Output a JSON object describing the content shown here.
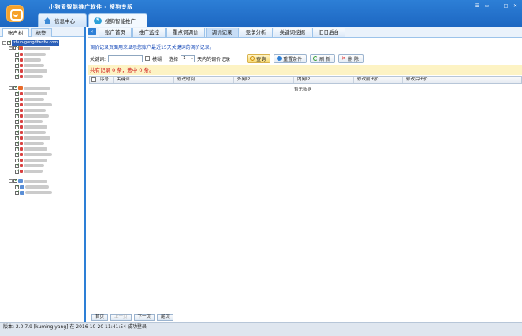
{
  "window": {
    "title": "小狗爱智能推广软件 - 搜狗专版"
  },
  "top_tabs": [
    {
      "label": "信息中心",
      "icon": "house-icon"
    },
    {
      "label": "搜狗智能推广",
      "icon": "sogou-icon"
    }
  ],
  "left": {
    "tabs": [
      "账户树",
      "标签"
    ],
    "tree_root": "zhuo-gongdfwdfw.com"
  },
  "nav_tabs": [
    "账户首页",
    "推广监控",
    "重点词调价",
    "调价记录",
    "竞争分析",
    "关键词挖掘",
    "旧日后台"
  ],
  "active_nav": "调价记录",
  "notice": "调价记录页面用来显示您账户最近15天关键词的调价记录。",
  "filter": {
    "keyword_label": "关键词:",
    "keyword_value": "",
    "fuzzy_label": "模糊",
    "select_label": "选择",
    "range_value": "1",
    "range_suffix": "天内的调价记录",
    "buttons": {
      "query": "查询",
      "reset": "重置条件",
      "refresh": "刷 新",
      "delete": "删 除"
    }
  },
  "summary": "共有记录 0 条，选中 0 条。",
  "grid": {
    "columns": [
      "序号",
      "关键词",
      "修改时间",
      "外网IP",
      "内网IP",
      "修改前出价",
      "修改后出价"
    ],
    "empty_text": "暂无数据"
  },
  "pager": {
    "first": "首页",
    "prev": "上一页",
    "next": "下一页",
    "last": "尾页"
  },
  "status": "版本: 2.0.7.9 [kuming yang] 在 2016-10-20 11:41:54 成功登录"
}
